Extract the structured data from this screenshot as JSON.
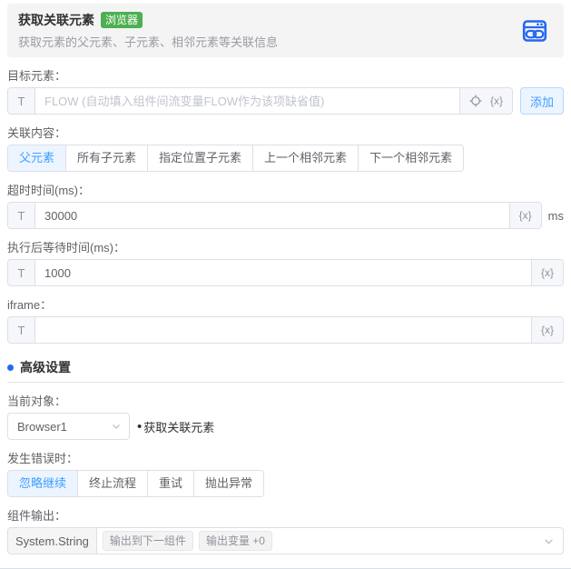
{
  "header": {
    "title": "获取关联元素",
    "badge": "浏览器",
    "subtitle": "获取元素的父元素、子元素、相邻元素等关联信息"
  },
  "common": {
    "text_prefix": "T",
    "var_icon": "{x}"
  },
  "fields": {
    "target": {
      "label": "目标元素：",
      "placeholder": "FLOW (自动填入组件间流变量FLOW作为该项缺省值)",
      "value": "",
      "add_button": "添加"
    },
    "relation": {
      "label": "关联内容：",
      "options": [
        "父元素",
        "所有子元素",
        "指定位置子元素",
        "上一个相邻元素",
        "下一个相邻元素"
      ],
      "selected": "父元素"
    },
    "timeout": {
      "label": "超时时间(ms)：",
      "value": "30000",
      "unit": "ms"
    },
    "wait_after": {
      "label": "执行后等待时间(ms)：",
      "value": "1000"
    },
    "iframe": {
      "label": "iframe：",
      "value": ""
    }
  },
  "advanced": {
    "title": "高级设置",
    "current_object": {
      "label": "当前对象：",
      "value": "Browser1",
      "note_bullet": "•",
      "note": "获取关联元素"
    },
    "on_error": {
      "label": "发生错误时：",
      "options": [
        "忽略继续",
        "终止流程",
        "重试",
        "抛出异常"
      ],
      "selected": "忽略继续"
    },
    "output": {
      "label": "组件输出：",
      "type": "System.String",
      "tags": [
        "输出到下一组件",
        "输出变量 +0"
      ]
    }
  },
  "colors": {
    "accent": "#409eff",
    "accent_bg": "#ecf5ff",
    "accent_border": "#b3d8ff",
    "badge_green": "#4caf50",
    "icon_blue": "#2468f2"
  }
}
